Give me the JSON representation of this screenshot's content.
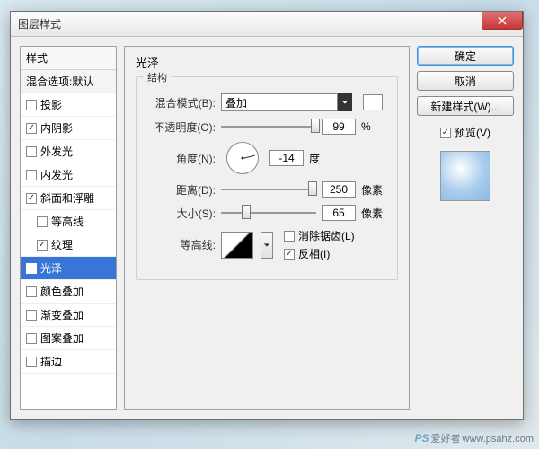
{
  "dialog": {
    "title": "图层样式"
  },
  "left": {
    "header": "样式",
    "blend": "混合选项:默认",
    "items": [
      {
        "label": "投影",
        "checked": false,
        "sub": false
      },
      {
        "label": "内阴影",
        "checked": true,
        "sub": false
      },
      {
        "label": "外发光",
        "checked": false,
        "sub": false
      },
      {
        "label": "内发光",
        "checked": false,
        "sub": false
      },
      {
        "label": "斜面和浮雕",
        "checked": true,
        "sub": false
      },
      {
        "label": "等高线",
        "checked": false,
        "sub": true
      },
      {
        "label": "纹理",
        "checked": true,
        "sub": true
      },
      {
        "label": "光泽",
        "checked": true,
        "sub": false,
        "selected": true
      },
      {
        "label": "颜色叠加",
        "checked": false,
        "sub": false
      },
      {
        "label": "渐变叠加",
        "checked": false,
        "sub": false
      },
      {
        "label": "图案叠加",
        "checked": false,
        "sub": false
      },
      {
        "label": "描边",
        "checked": false,
        "sub": false
      }
    ]
  },
  "center": {
    "title": "光泽",
    "group": "结构",
    "blendModeLabel": "混合模式(B):",
    "blendModeValue": "叠加",
    "opacityLabel": "不透明度(O):",
    "opacityValue": "99",
    "opacityUnit": "%",
    "angleLabel": "角度(N):",
    "angleValue": "-14",
    "angleUnit": "度",
    "distanceLabel": "距离(D):",
    "distanceValue": "250",
    "distanceUnit": "像素",
    "sizeLabel": "大小(S):",
    "sizeValue": "65",
    "sizeUnit": "像素",
    "contourLabel": "等高线:",
    "antiAlias": "消除锯齿(L)",
    "invert": "反相(I)"
  },
  "right": {
    "ok": "确定",
    "cancel": "取消",
    "newStyle": "新建样式(W)...",
    "preview": "预览(V)"
  },
  "watermark": {
    "ps": "PS",
    "site": "爱好者",
    "url": "www.psahz.com"
  }
}
